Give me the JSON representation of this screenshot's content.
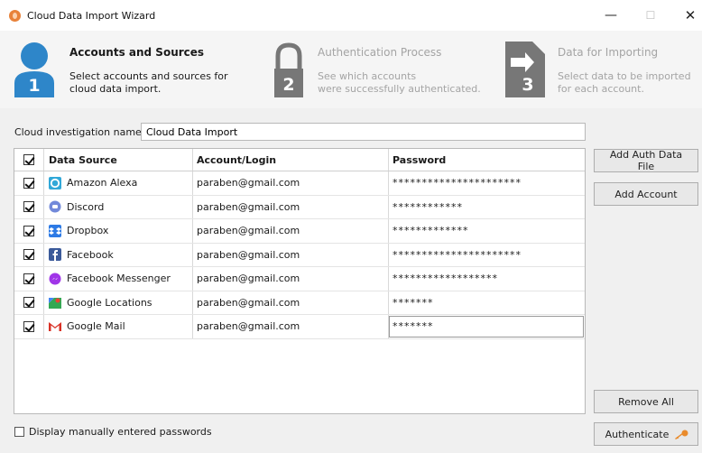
{
  "window": {
    "title": "Cloud Data Import Wizard",
    "minimize": "—",
    "maximize": "☐",
    "close": "✕"
  },
  "steps": [
    {
      "number": "1",
      "title": "Accounts and Sources",
      "desc1": "Select accounts and sources for",
      "desc2": "cloud data import.",
      "icon": "user-icon",
      "active": true
    },
    {
      "number": "2",
      "title": "Authentication Process",
      "desc1": "See which accounts",
      "desc2": "were successfully authenticated.",
      "icon": "lock-icon",
      "active": false
    },
    {
      "number": "3",
      "title": "Data for Importing",
      "desc1": "Select data to be imported",
      "desc2": "for each account.",
      "icon": "document-arrow-icon",
      "active": false
    }
  ],
  "investigation": {
    "label": "Cloud investigation name:",
    "value": "Cloud Data Import"
  },
  "table": {
    "headers": {
      "source": "Data Source",
      "account": "Account/Login",
      "password": "Password"
    },
    "rows": [
      {
        "source": "Amazon Alexa",
        "account": "paraben@gmail.com",
        "password": "**********************",
        "icon": "alexa-icon",
        "color": "#31a8d8"
      },
      {
        "source": "Discord",
        "account": "paraben@gmail.com",
        "password": "************",
        "icon": "discord-icon",
        "color": "#7289da"
      },
      {
        "source": "Dropbox",
        "account": "paraben@gmail.com",
        "password": "*************",
        "icon": "dropbox-icon",
        "color": "#2d7ae5"
      },
      {
        "source": "Facebook",
        "account": "paraben@gmail.com",
        "password": "**********************",
        "icon": "facebook-icon",
        "color": "#3b5a9a"
      },
      {
        "source": "Facebook Messenger",
        "account": "paraben@gmail.com",
        "password": "******************",
        "icon": "messenger-icon",
        "color": "#a035e8"
      },
      {
        "source": "Google Locations",
        "account": "paraben@gmail.com",
        "password": "*******",
        "icon": "google-maps-icon",
        "color": "#34a853"
      },
      {
        "source": "Google Mail",
        "account": "paraben@gmail.com",
        "password": "*******",
        "icon": "gmail-icon",
        "color": "#d93025"
      }
    ]
  },
  "buttons": {
    "add_auth_file": "Add Auth Data File",
    "add_account": "Add Account",
    "remove_all": "Remove All",
    "authenticate": "Authenticate"
  },
  "display_passwords_label": "Display manually entered passwords",
  "colors": {
    "accent_blue": "#2e86c9",
    "step_gray": "#777777"
  }
}
